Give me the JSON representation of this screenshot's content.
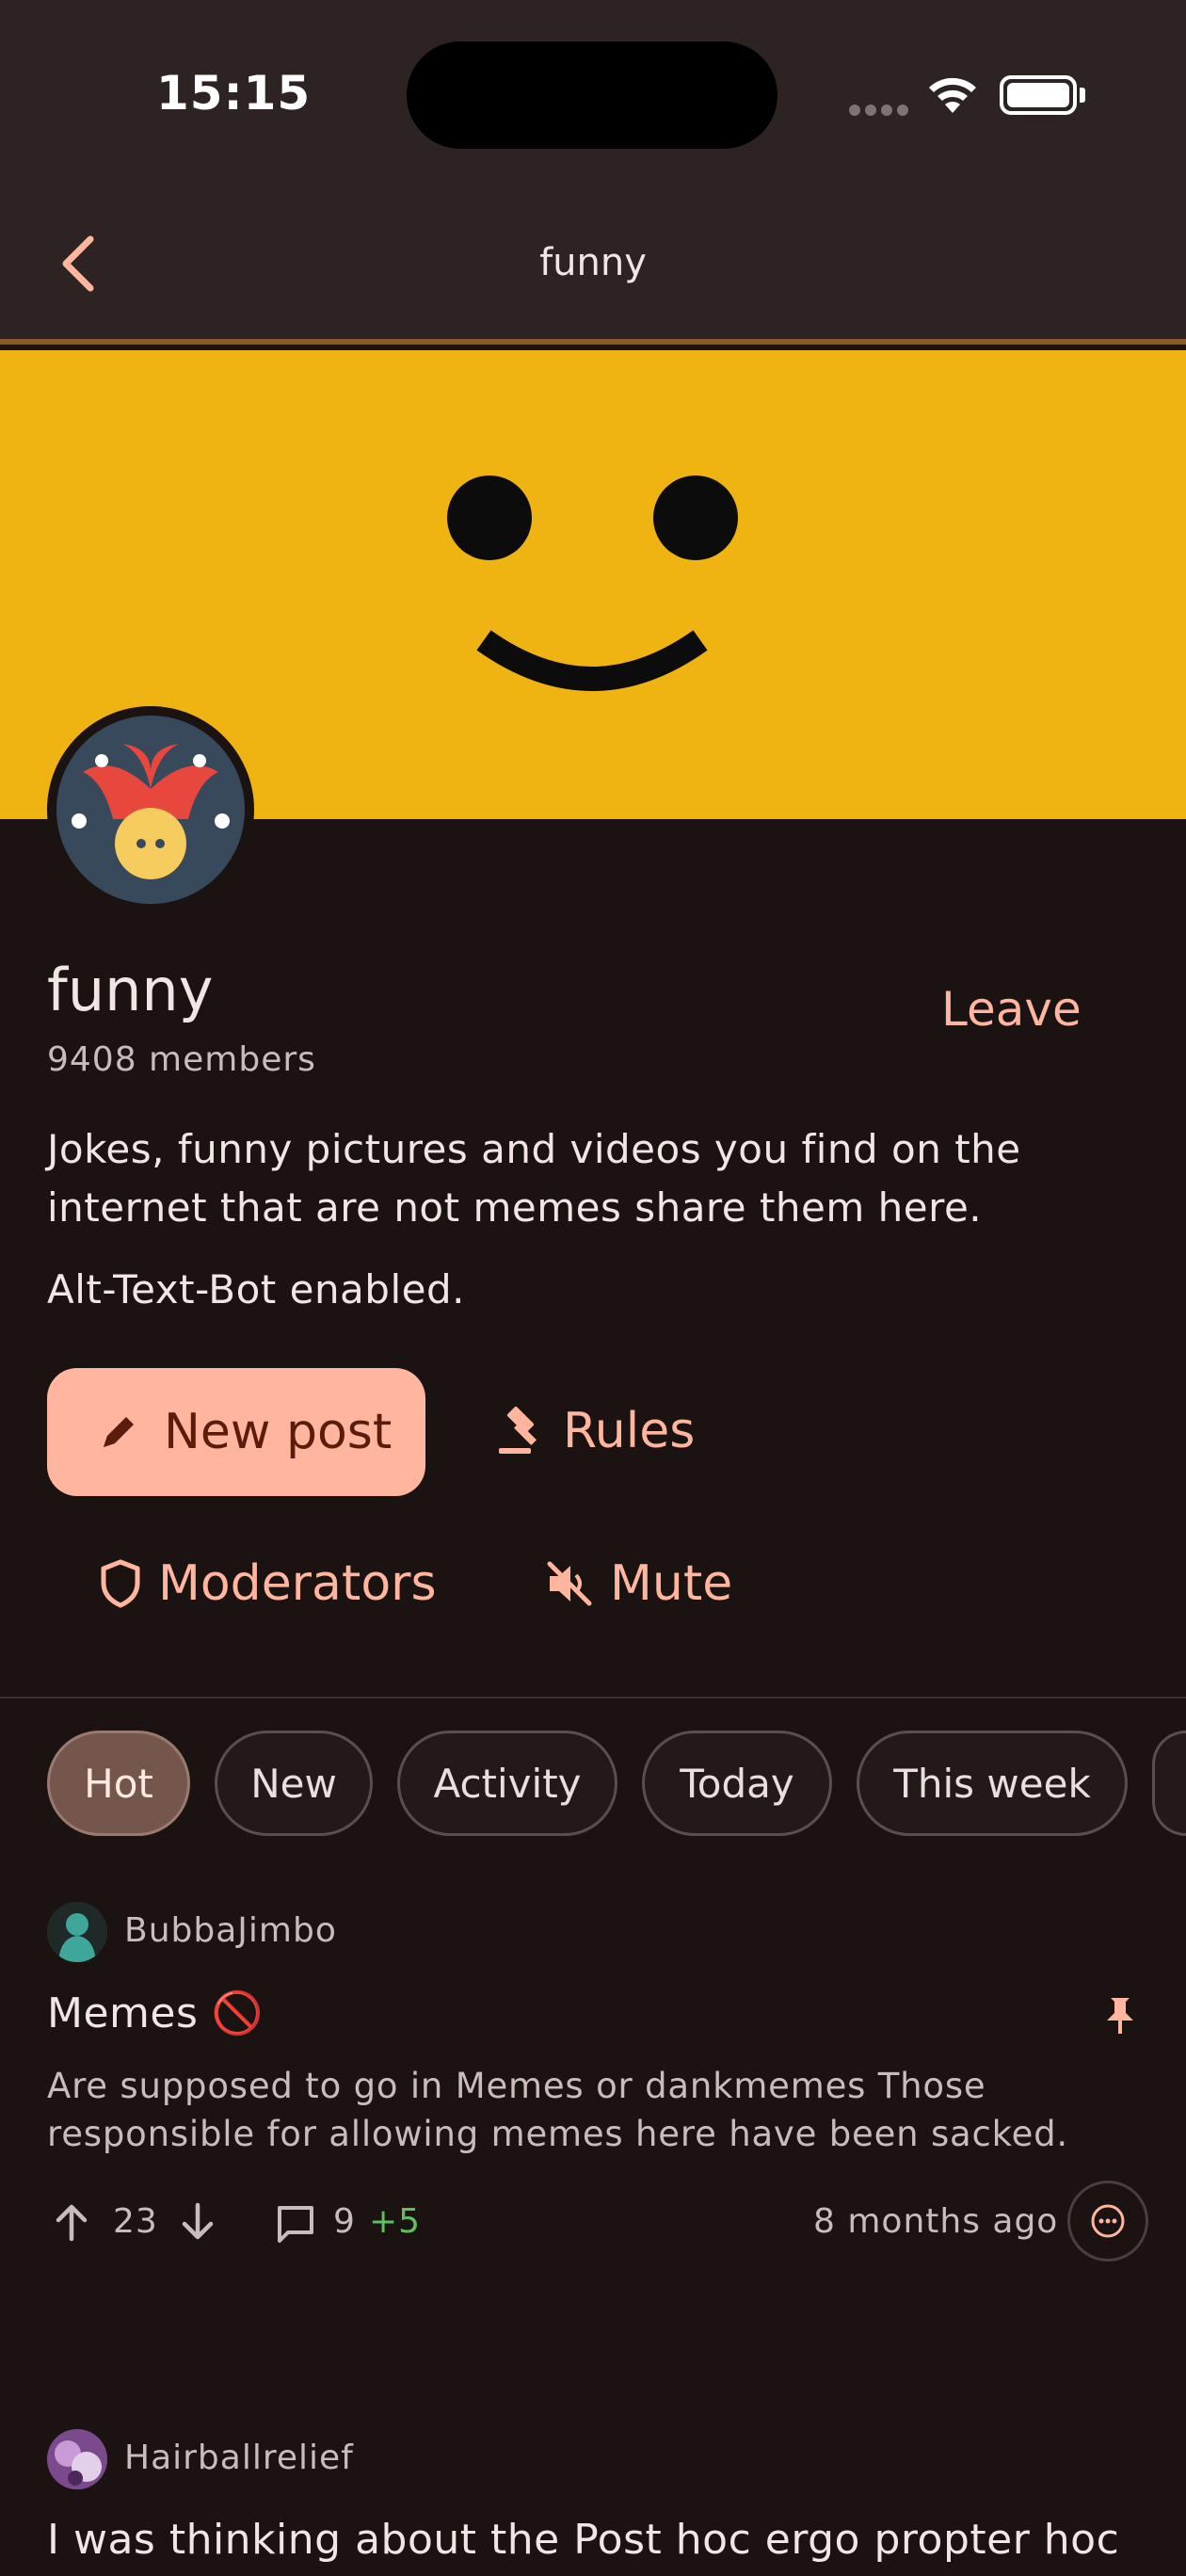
{
  "status_bar": {
    "time": "15:15"
  },
  "app_bar": {
    "title": "funny"
  },
  "community": {
    "name": "funny",
    "members": "9408 members",
    "leave_label": "Leave",
    "description": "Jokes, funny pictures and videos you find on the internet that are not memes share them here.",
    "alt_text_note": "Alt-Text-Bot enabled."
  },
  "actions": {
    "new_post": "New post",
    "rules": "Rules",
    "moderators": "Moderators",
    "mute": "Mute"
  },
  "sort_chips": [
    {
      "label": "Hot",
      "selected": true
    },
    {
      "label": "New",
      "selected": false
    },
    {
      "label": "Activity",
      "selected": false
    },
    {
      "label": "Today",
      "selected": false
    },
    {
      "label": "This week",
      "selected": false
    }
  ],
  "posts": [
    {
      "author": "BubbaJimbo",
      "title": "Memes",
      "title_emoji": "🚫",
      "pinned": true,
      "body": "Are supposed to go in Memes or dankmemes Those responsible for allowing memes here have been sacked.",
      "score": "23",
      "comments": "9",
      "new_comments": "+5",
      "age": "8 months ago"
    },
    {
      "author": "Hairballrelief",
      "title": "I was thinking about the Post hoc ergo propter hoc"
    }
  ],
  "colors": {
    "accent": "#ffb59e",
    "banner": "#f0b412",
    "background": "#1b1212",
    "new_comments": "#5fbf5f"
  }
}
